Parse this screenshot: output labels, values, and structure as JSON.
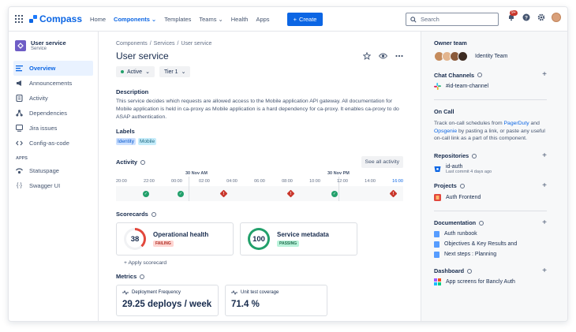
{
  "nav": {
    "brand": "Compass",
    "links": [
      "Home",
      "Components",
      "Templates",
      "Teams",
      "Health",
      "Apps"
    ],
    "create": "Create",
    "search_placeholder": "Search",
    "notifications": "9+"
  },
  "sidebar": {
    "service_name": "User service",
    "service_type": "Service",
    "items": [
      "Overview",
      "Announcements",
      "Activity",
      "Dependencies",
      "Jira issues",
      "Config-as-code"
    ],
    "apps_heading": "APPS",
    "apps": [
      "Statuspage",
      "Swagger UI"
    ]
  },
  "main": {
    "breadcrumbs": [
      "Components",
      "Services",
      "User service"
    ],
    "title": "User service",
    "status": "Active",
    "tier": "Tier 1",
    "description_heading": "Description",
    "description": "This service decides which requests are allowed access to the Mobile application API gateway. All documentation for Mobile application is held in ca-proxy as Mobile application is a hard dependency for ca-proxy. It enables ca-proxy to do ASAP authentication.",
    "labels_heading": "Labels",
    "labels": [
      "Identity",
      "Mobile"
    ],
    "activity_heading": "Activity",
    "see_all": "See all activity",
    "timeline": {
      "days": [
        "30 Nov AM",
        "30 Nov PM"
      ],
      "ticks": [
        "20:00",
        "22:00",
        "00:00",
        "02:00",
        "04:00",
        "06:00",
        "08:00",
        "10:00",
        "12:00",
        "14:00",
        "16:00"
      ],
      "events": [
        {
          "type": "ok",
          "hour_index": 1.3
        },
        {
          "type": "ok",
          "hour_index": 3
        },
        {
          "type": "bad",
          "hour_index": 5.1
        },
        {
          "type": "bad",
          "hour_index": 8.4
        },
        {
          "type": "ok",
          "hour_index": 10.5
        },
        {
          "type": "bad",
          "hour_index": 13.4
        }
      ]
    },
    "scorecards_heading": "Scorecards",
    "scorecards": [
      {
        "score": "38",
        "name": "Operational health",
        "status": "FAILING",
        "pct": 0.38
      },
      {
        "score": "100",
        "name": "Service metadata",
        "status": "PASSING",
        "pct": 1.0
      }
    ],
    "apply_scorecard": "+ Apply scorecard",
    "metrics_heading": "Metrics",
    "metrics": [
      {
        "name": "Deployment Frequency",
        "value": "29.25 deploys / week"
      },
      {
        "name": "Unit test coverage",
        "value": "71.4 %"
      }
    ]
  },
  "right": {
    "owner_heading": "Owner team",
    "owner_team": "Identity Team",
    "chat_heading": "Chat Channels",
    "chat_channel": "#id-team-channel",
    "oncall_heading": "On Call",
    "oncall_text_1": "Track on-call schedules from ",
    "oncall_link_1": "PagerDuty",
    "oncall_text_2": " and ",
    "oncall_link_2": "Opsgenie",
    "oncall_text_3": " by pasting a link, or paste any useful on-call link as a part of this component.",
    "repos_heading": "Repositories",
    "repo_name": "id-auth",
    "repo_sub": "Last commit 4 days ago",
    "projects_heading": "Projects",
    "project_name": "Auth Frontend",
    "docs_heading": "Documentation",
    "docs": [
      "Auth runbook",
      "Objectives & Key Results and",
      "Next steps : Planning"
    ],
    "dashboard_heading": "Dashboard",
    "dashboard_item": "App screens for Bancly Auth"
  },
  "colors": {
    "accent": "#0C66E4",
    "success": "#22A06B",
    "danger": "#C9372C"
  }
}
